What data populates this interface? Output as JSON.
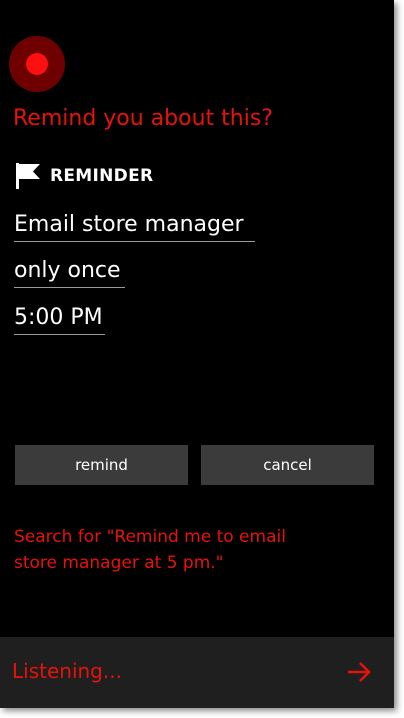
{
  "colors": {
    "accent": "#e8120c",
    "background": "#000000",
    "button": "#3b3b3b",
    "bottom_bar": "#1f1f1f"
  },
  "prompt": "Remind you about this?",
  "reminder": {
    "icon": "flag-icon",
    "label": "REMINDER",
    "title": "Email store manager",
    "repeat": "only once",
    "time": "5:00 PM"
  },
  "buttons": {
    "remind": "remind",
    "cancel": "cancel"
  },
  "hint": {
    "line1": "Search for \"Remind me to email",
    "line2": "store manager at 5 pm.\""
  },
  "status": {
    "text": "Listening...",
    "icon": "arrow-right-icon"
  }
}
